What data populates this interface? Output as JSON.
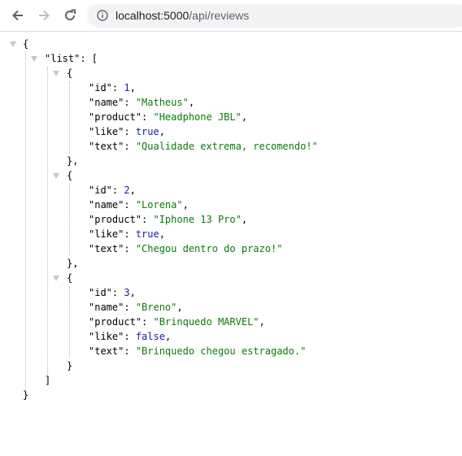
{
  "browser": {
    "url_host": "localhost:5000",
    "url_path": "/api/reviews"
  },
  "json": {
    "root_key": "\"list\"",
    "items": [
      {
        "id": "1",
        "name": "\"Matheus\"",
        "product": "\"Headphone JBL\"",
        "like": "true",
        "text": "\"Qualidade extrema, recomendo!\""
      },
      {
        "id": "2",
        "name": "\"Lorena\"",
        "product": "\"Iphone 13 Pro\"",
        "like": "true",
        "text": "\"Chegou dentro do prazo!\""
      },
      {
        "id": "3",
        "name": "\"Breno\"",
        "product": "\"Brinquedo MARVEL\"",
        "like": "false",
        "text": "\"Brinquedo chegou estragado.\""
      }
    ],
    "keys": {
      "id": "\"id\"",
      "name": "\"name\"",
      "product": "\"product\"",
      "like": "\"like\"",
      "text": "\"text\""
    }
  }
}
